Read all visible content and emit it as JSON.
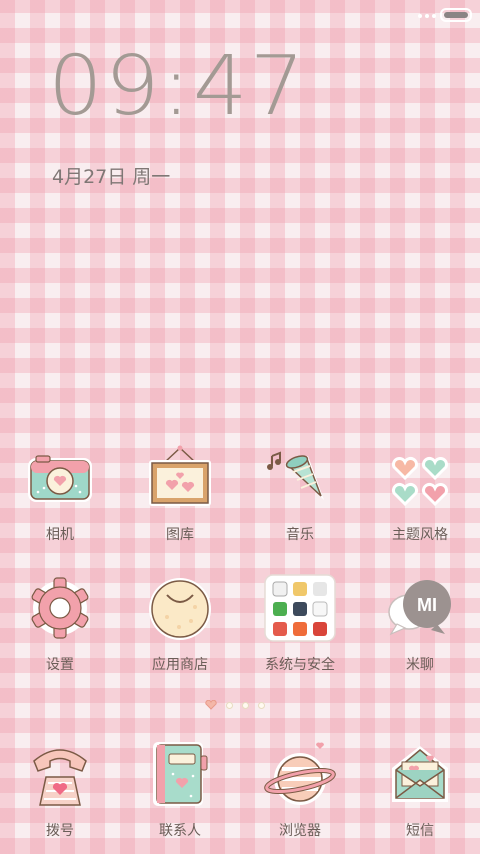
{
  "status": {
    "icons": [
      "more-dots-icon",
      "battery-icon"
    ]
  },
  "lockclock": {
    "time": "09:47",
    "date": "4月27日 周一"
  },
  "apps_row1": [
    {
      "label": "相机",
      "icon": "camera-icon"
    },
    {
      "label": "图库",
      "icon": "picture-frame-icon"
    },
    {
      "label": "音乐",
      "icon": "music-cone-icon"
    },
    {
      "label": "主题风格",
      "icon": "hearts-icon"
    }
  ],
  "apps_row2": [
    {
      "label": "设置",
      "icon": "gear-icon"
    },
    {
      "label": "应用商店",
      "icon": "bun-icon"
    },
    {
      "label": "系统与安全",
      "icon": "folder-grid-icon"
    },
    {
      "label": "米聊",
      "icon": "chat-bubble-icon"
    }
  ],
  "dock": [
    {
      "label": "拨号",
      "icon": "telephone-icon"
    },
    {
      "label": "联系人",
      "icon": "contacts-book-icon"
    },
    {
      "label": "浏览器",
      "icon": "planet-icon"
    },
    {
      "label": "短信",
      "icon": "envelope-icon"
    }
  ],
  "pager": {
    "pages": 4,
    "current": 1
  },
  "chat_icon_text": "MI",
  "colors": {
    "pink": "#f2a1ab",
    "mint": "#9fd8c9",
    "cream": "#fbf1dc",
    "brown": "#7b5a45"
  }
}
